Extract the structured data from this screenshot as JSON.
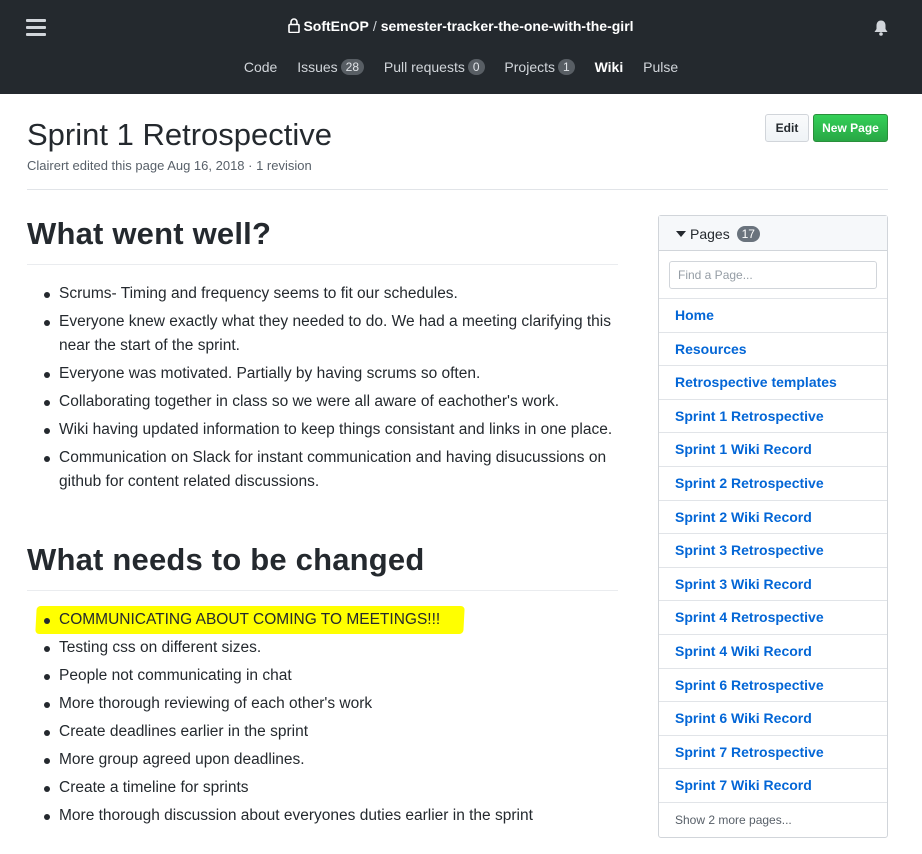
{
  "header": {
    "owner": "SoftEnOP",
    "separator": "/",
    "repo": "semester-tracker-the-one-with-the-girl",
    "nav": [
      {
        "label": "Code",
        "count": null
      },
      {
        "label": "Issues",
        "count": "28"
      },
      {
        "label": "Pull requests",
        "count": "0"
      },
      {
        "label": "Projects",
        "count": "1"
      },
      {
        "label": "Wiki",
        "count": null
      },
      {
        "label": "Pulse",
        "count": null
      }
    ],
    "active_tab": "Wiki"
  },
  "page": {
    "title": "Sprint 1 Retrospective",
    "meta": "Clairert edited this page Aug 16, 2018 · 1 revision",
    "edit_label": "Edit",
    "new_page_label": "New Page"
  },
  "article": {
    "section1": {
      "heading": "What went well?",
      "items": [
        "Scrums- Timing and frequency seems to fit our schedules.",
        "Everyone knew exactly what they needed to do. We had a meeting clarifying this near the start of the sprint.",
        "Everyone was motivated. Partially by having scrums so often.",
        "Collaborating together in class so we were all aware of eachother's work.",
        "Wiki having updated information to keep things consistant and links in one place.",
        "Communication on Slack for instant communication and having disucussions on github for content related discussions."
      ]
    },
    "section2": {
      "heading": "What needs to be changed",
      "items": [
        "COMMUNICATING ABOUT COMING TO MEETINGS!!!",
        "Testing css on different sizes.",
        "People not communicating in chat",
        "More thorough reviewing of each other's work",
        "Create deadlines earlier in the sprint",
        "More group agreed upon deadlines.",
        "Create a timeline for sprints",
        "More thorough discussion about everyones duties earlier in the sprint"
      ],
      "highlight_color": "#ffff00"
    }
  },
  "sidebar": {
    "title": "Pages",
    "count": "17",
    "search_placeholder": "Find a Page...",
    "pages": [
      "Home",
      "Resources",
      "Retrospective templates",
      "Sprint 1 Retrospective",
      "Sprint 1 Wiki Record",
      "Sprint 2 Retrospective",
      "Sprint 2 Wiki Record",
      "Sprint 3 Retrospective",
      "Sprint 3 Wiki Record",
      "Sprint 4 Retrospective",
      "Sprint 4 Wiki Record",
      "Sprint 6 Retrospective",
      "Sprint 6 Wiki Record",
      "Sprint 7 Retrospective",
      "Sprint 7 Wiki Record"
    ],
    "more_label": "Show 2 more pages..."
  },
  "colors": {
    "header_bg": "#24292e",
    "link": "#0366d6",
    "new_button": "#28a745",
    "highlight": "#ffff00"
  },
  "icons": [
    "menu-icon",
    "lock-icon",
    "bell-icon",
    "caret-down-icon"
  ]
}
